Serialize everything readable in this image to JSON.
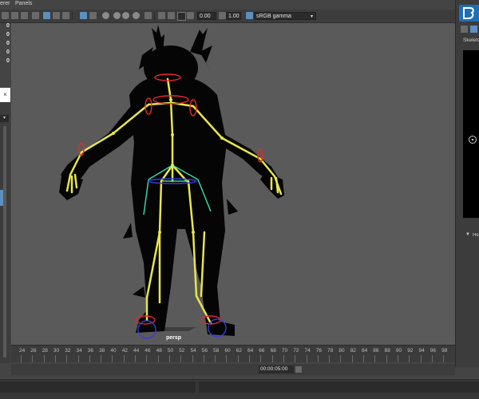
{
  "menu": {
    "renderer": "erer",
    "panels": "Panels"
  },
  "toolbar": {
    "exposure": "0.00",
    "gamma": "1.00",
    "colorspace": "sRGB gamma"
  },
  "hud": {
    "values": [
      "0",
      "0",
      "0",
      "0",
      "0"
    ]
  },
  "viewport": {
    "camera_label": "persp"
  },
  "left_panel": {
    "close_glyph": "×"
  },
  "right_panel": {
    "title": "Skeleto",
    "footer_label": "He"
  },
  "timeline": {
    "ticks": [
      "24",
      "26",
      "28",
      "30",
      "32",
      "34",
      "36",
      "38",
      "40",
      "42",
      "44",
      "46",
      "48",
      "50",
      "52",
      "54",
      "56",
      "58",
      "60",
      "62",
      "64",
      "66",
      "68",
      "70",
      "72",
      "74",
      "76",
      "78",
      "80",
      "82",
      "84",
      "86",
      "88",
      "90",
      "92",
      "94",
      "96",
      "98"
    ],
    "timecode": "00:00:05:00"
  },
  "colors": {
    "accent": "#5c8fbf",
    "joint": "#e8e64a",
    "joint_outline": "#e62a2a",
    "ik": "#35d6a6"
  }
}
